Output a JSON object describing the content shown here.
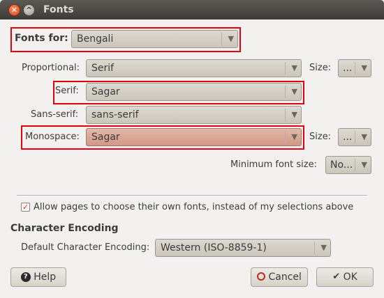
{
  "window": {
    "title": "Fonts"
  },
  "fonts_for": {
    "label": "Fonts for:",
    "value": "Bengali"
  },
  "proportional": {
    "label": "Proportional:",
    "value": "Serif",
    "size_label": "Size:",
    "size_value": "..."
  },
  "serif": {
    "label": "Serif:",
    "value": "Sagar"
  },
  "sans_serif": {
    "label": "Sans-serif:",
    "value": "sans-serif"
  },
  "monospace": {
    "label": "Monospace:",
    "value": "Sagar",
    "size_label": "Size:",
    "size_value": "..."
  },
  "minimum": {
    "label": "Minimum font size:",
    "value": "No..."
  },
  "allow_pages": {
    "label": "Allow pages to choose their own fonts, instead of my selections above",
    "checked": true
  },
  "encoding": {
    "heading": "Character Encoding",
    "label": "Default Character Encoding:",
    "value": "Western (ISO-8859-1)"
  },
  "buttons": {
    "help": "Help",
    "cancel": "Cancel",
    "ok": "OK"
  },
  "colors": {
    "highlight": "#e0000f",
    "titlebar": "#3d3c37",
    "accent": "#c34113"
  },
  "icons": [
    "close-icon",
    "maximize-icon",
    "dropdown-arrow-icon",
    "help-icon",
    "cancel-icon",
    "checkmark-icon"
  ]
}
